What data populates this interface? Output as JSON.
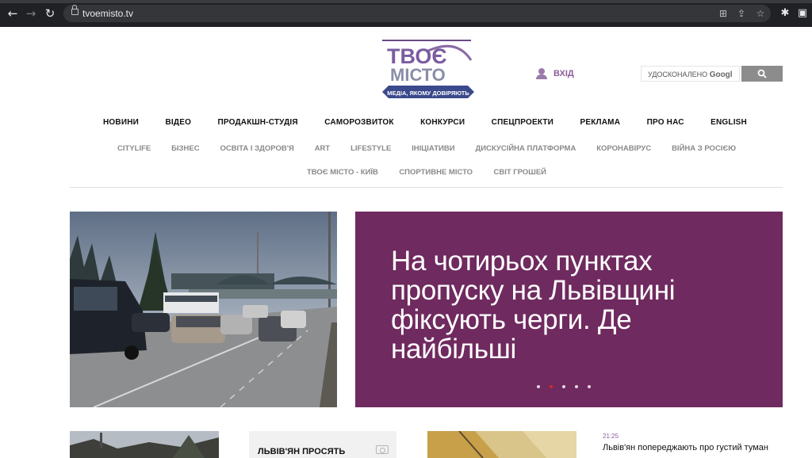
{
  "browser": {
    "url": "tvoemisto.tv",
    "icons": [
      "back-arrow-icon",
      "forward-arrow-icon",
      "reload-icon",
      "lock-icon",
      "translate-icon",
      "share-icon",
      "bookmark-star-icon",
      "extensions-puzzle-icon",
      "sidebar-panel-icon"
    ]
  },
  "header": {
    "logo": {
      "line1": "ТВОЄ",
      "line2": "МІСТО",
      "ribbon": "МЕДІА, ЯКОМУ ДОВІРЯЮТЬ"
    },
    "login_label": "ВХІД",
    "search": {
      "placeholder_prefix": "УДОСКОНАЛЕНО",
      "brand": "Googl"
    }
  },
  "nav": {
    "primary": [
      "НОВИНИ",
      "ВІДЕО",
      "ПРОДАКШН-СТУДІЯ",
      "САМОРОЗВИТОК",
      "КОНКУРСИ",
      "СПЕЦПРОЕКТИ",
      "РЕКЛАМА",
      "ПРО НАС",
      "ENGLISH"
    ],
    "secondary": [
      "CITYLIFE",
      "БІЗНЕС",
      "ОСВІТА І ЗДОРОВ'Я",
      "ART",
      "LIFESTYLE",
      "ІНІЦІАТИВИ",
      "ДИСКУСІЙНА ПЛАТФОРМА",
      "КОРОНАВІРУС",
      "ВІЙНА З РОСІЄЮ"
    ],
    "tertiary": [
      "ТВОЄ МІСТО - КИЇВ",
      "СПОРТИВНЕ МІСТО",
      "СВІТ ГРОШЕЙ"
    ]
  },
  "hero": {
    "title": "На чотирьох пунктах пропуску на Львівщині фіксують черги. Де найбільші",
    "slides_count": 5,
    "active_slide": 2,
    "colors": {
      "panel": "#6f2a5f",
      "active_dot": "#d42a2a"
    }
  },
  "bottom": {
    "card_title": "ЛЬВІВ'ЯН ПРОСЯТЬ",
    "news": {
      "time": "21:25",
      "text": "Львів'ян попереджають про густий туман"
    }
  },
  "colors": {
    "accent": "#8a5d9b",
    "logo_blue": "#3b4a8c"
  }
}
